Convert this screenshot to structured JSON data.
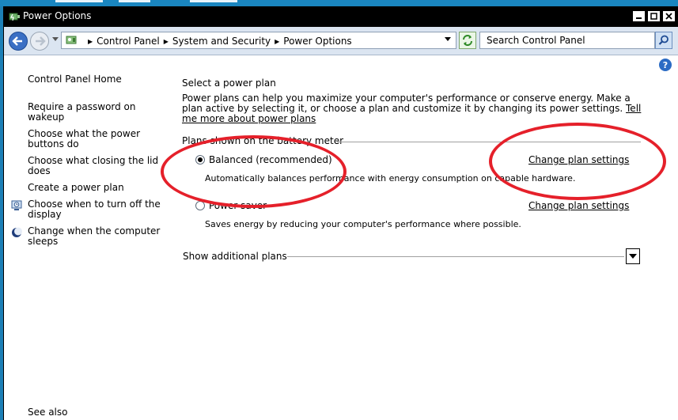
{
  "window": {
    "title": "Power Options"
  },
  "address": {
    "breadcrumbs": [
      "Control Panel",
      "System and Security",
      "Power Options"
    ],
    "search_placeholder": "Search Control Panel"
  },
  "help_label": "?",
  "sidebar": {
    "home": "Control Panel Home",
    "items": [
      {
        "label": "Require a password on wakeup"
      },
      {
        "label": "Choose what the power buttons do"
      },
      {
        "label": "Choose what closing the lid does"
      },
      {
        "label": "Create a power plan"
      },
      {
        "label": "Choose when to turn off the display",
        "icon": "display-icon"
      },
      {
        "label": "Change when the computer sleeps",
        "icon": "moon-icon"
      }
    ],
    "see_also": "See also"
  },
  "main": {
    "heading": "Select a power plan",
    "intro": "Power plans can help you maximize your computer's performance or conserve energy. Make a plan active by selecting it, or choose a plan and customize it by changing its power settings.",
    "intro_link": "Tell me more about power plans",
    "group_label": "Plans shown on the battery meter",
    "plans": [
      {
        "name": "Balanced (recommended)",
        "description": "Automatically balances performance with energy consumption on capable hardware.",
        "link": "Change plan settings",
        "selected": true
      },
      {
        "name": "Power saver",
        "description": "Saves energy by reducing your computer's performance where possible.",
        "link": "Change plan settings",
        "selected": false
      }
    ],
    "additional_plans": "Show additional plans"
  },
  "colors": {
    "annotation": "#e5202a",
    "titlebar": "#000000",
    "desktop": "#1c7fb6"
  }
}
